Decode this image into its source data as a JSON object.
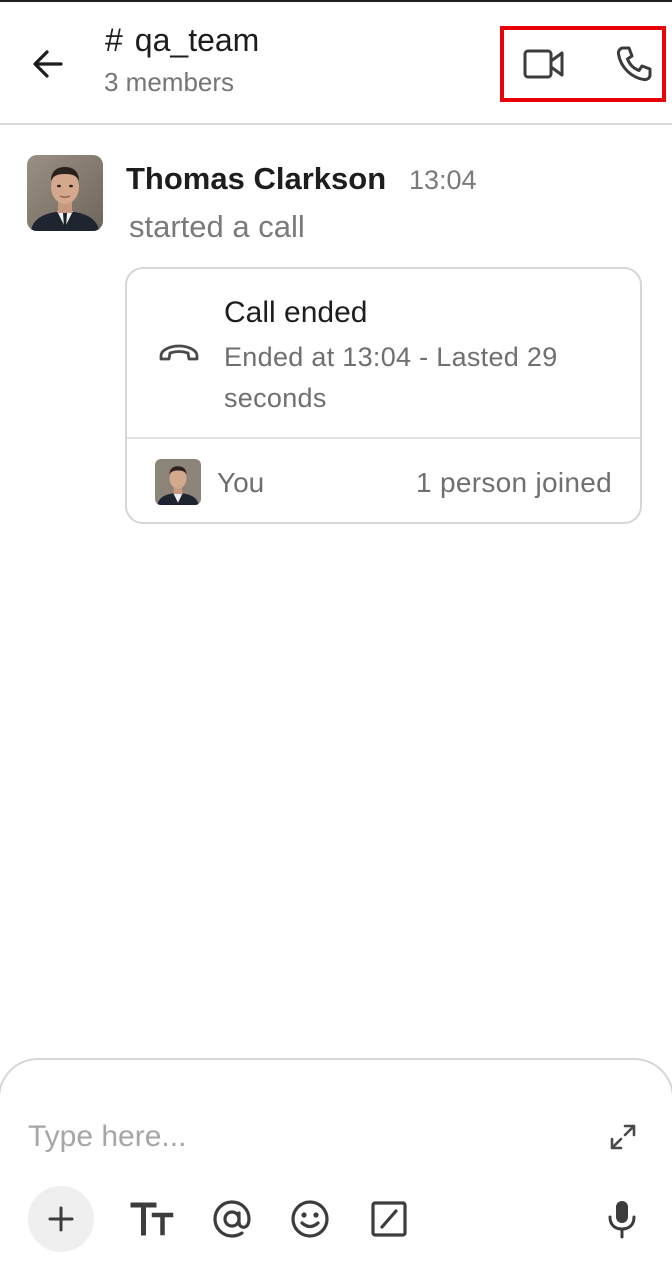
{
  "header": {
    "hash_symbol": "#",
    "channel_name": "qa_team",
    "member_count": "3 members",
    "icons": [
      "back-arrow-icon",
      "video-camera-icon",
      "phone-icon"
    ],
    "highlight_color": "#e8000b"
  },
  "message": {
    "sender": "Thomas Clarkson",
    "time": "13:04",
    "text": "started a call",
    "avatar": "avatar-photo"
  },
  "call_card": {
    "title": "Call ended",
    "detail": "Ended at 13:04 - Lasted 29 seconds",
    "participant": "You",
    "joined": "1 person joined",
    "icon": "hang-up-icon"
  },
  "composer": {
    "placeholder": "Type here...",
    "toolbar_icons": [
      "plus-icon",
      "text-format-icon",
      "at-mention-icon",
      "emoji-icon",
      "slash-command-icon",
      "microphone-icon"
    ],
    "expand_icon": "expand-icon"
  }
}
